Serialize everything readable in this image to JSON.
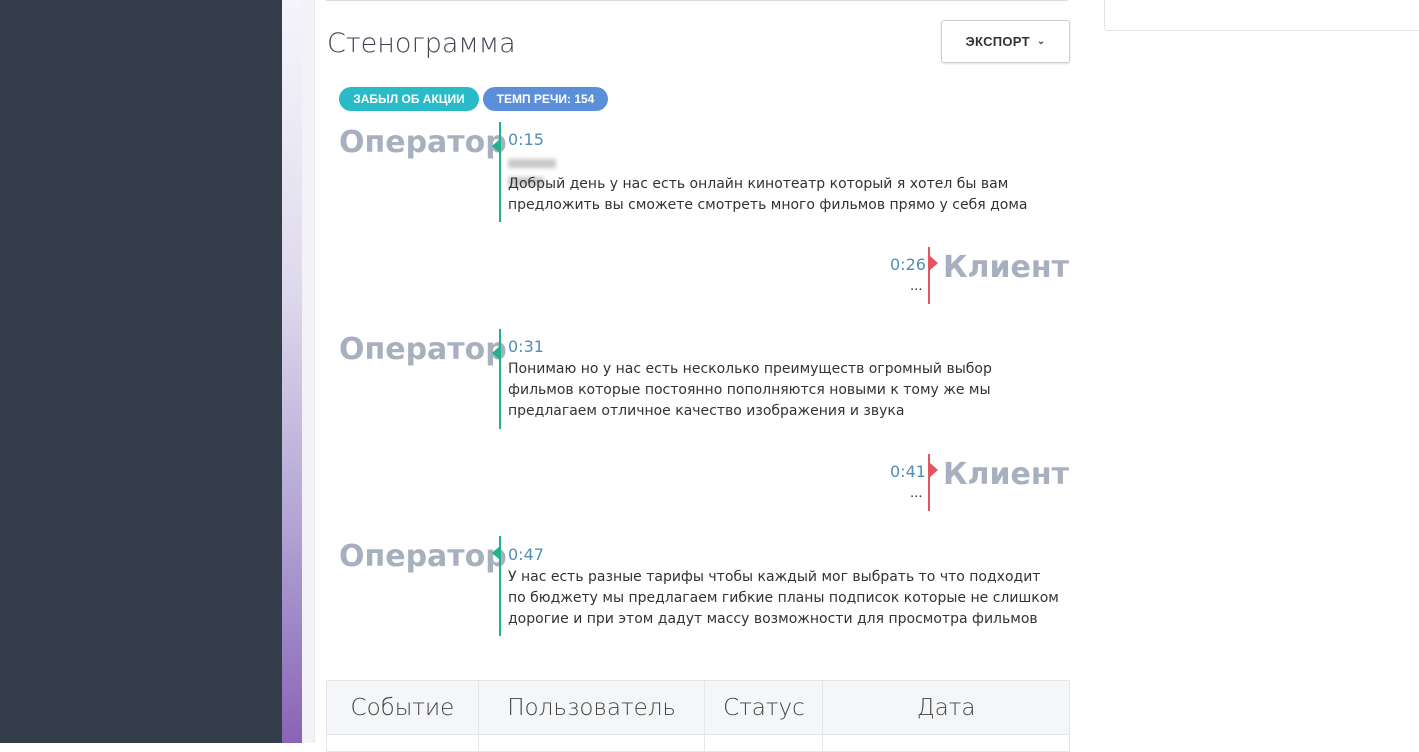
{
  "transcript": {
    "title": "Стенограмма",
    "export_label": "ЭКСПОРТ",
    "tags": [
      "ЗАБЫЛ ОБ АКЦИИ",
      "ТЕМП РЕЧИ: 154"
    ],
    "entries": [
      {
        "speaker": "Оператор",
        "time": "0:15",
        "lines": [
          "Добрый день у нас есть онлайн кинотеатр который я хотел бы вам",
          "предложить вы сможете смотреть много фильмов прямо у себя дома"
        ]
      },
      {
        "speaker": "Клиент",
        "time": "0:26",
        "text": "..."
      },
      {
        "speaker": "Оператор",
        "time": "0:31",
        "lines": [
          "Понимаю но у нас есть несколько преимуществ огромный выбор",
          "фильмов которые постоянно пополняются новыми к тому же мы",
          "предлагаем отличное качество изображения и звука"
        ]
      },
      {
        "speaker": "Клиент",
        "time": "0:41",
        "text": "..."
      },
      {
        "speaker": "Оператор",
        "time": "0:47",
        "lines": [
          "У нас есть разные тарифы чтобы каждый мог выбрать то что подходит",
          "по бюджету мы предлагаем гибкие планы подписок которые не слишком",
          "дорогие и при этом дадут массу возможности для просмотра фильмов"
        ]
      }
    ]
  },
  "events_table": {
    "headers": [
      "Событие",
      "Пользователь",
      "Статус",
      "Дата"
    ]
  },
  "colors": {
    "operator_accent": "#1fb28c",
    "client_accent": "#e45361",
    "tag_primary": "#29bcc8",
    "tag_secondary": "#5b8fd9",
    "sidebar": "#343e4b"
  }
}
